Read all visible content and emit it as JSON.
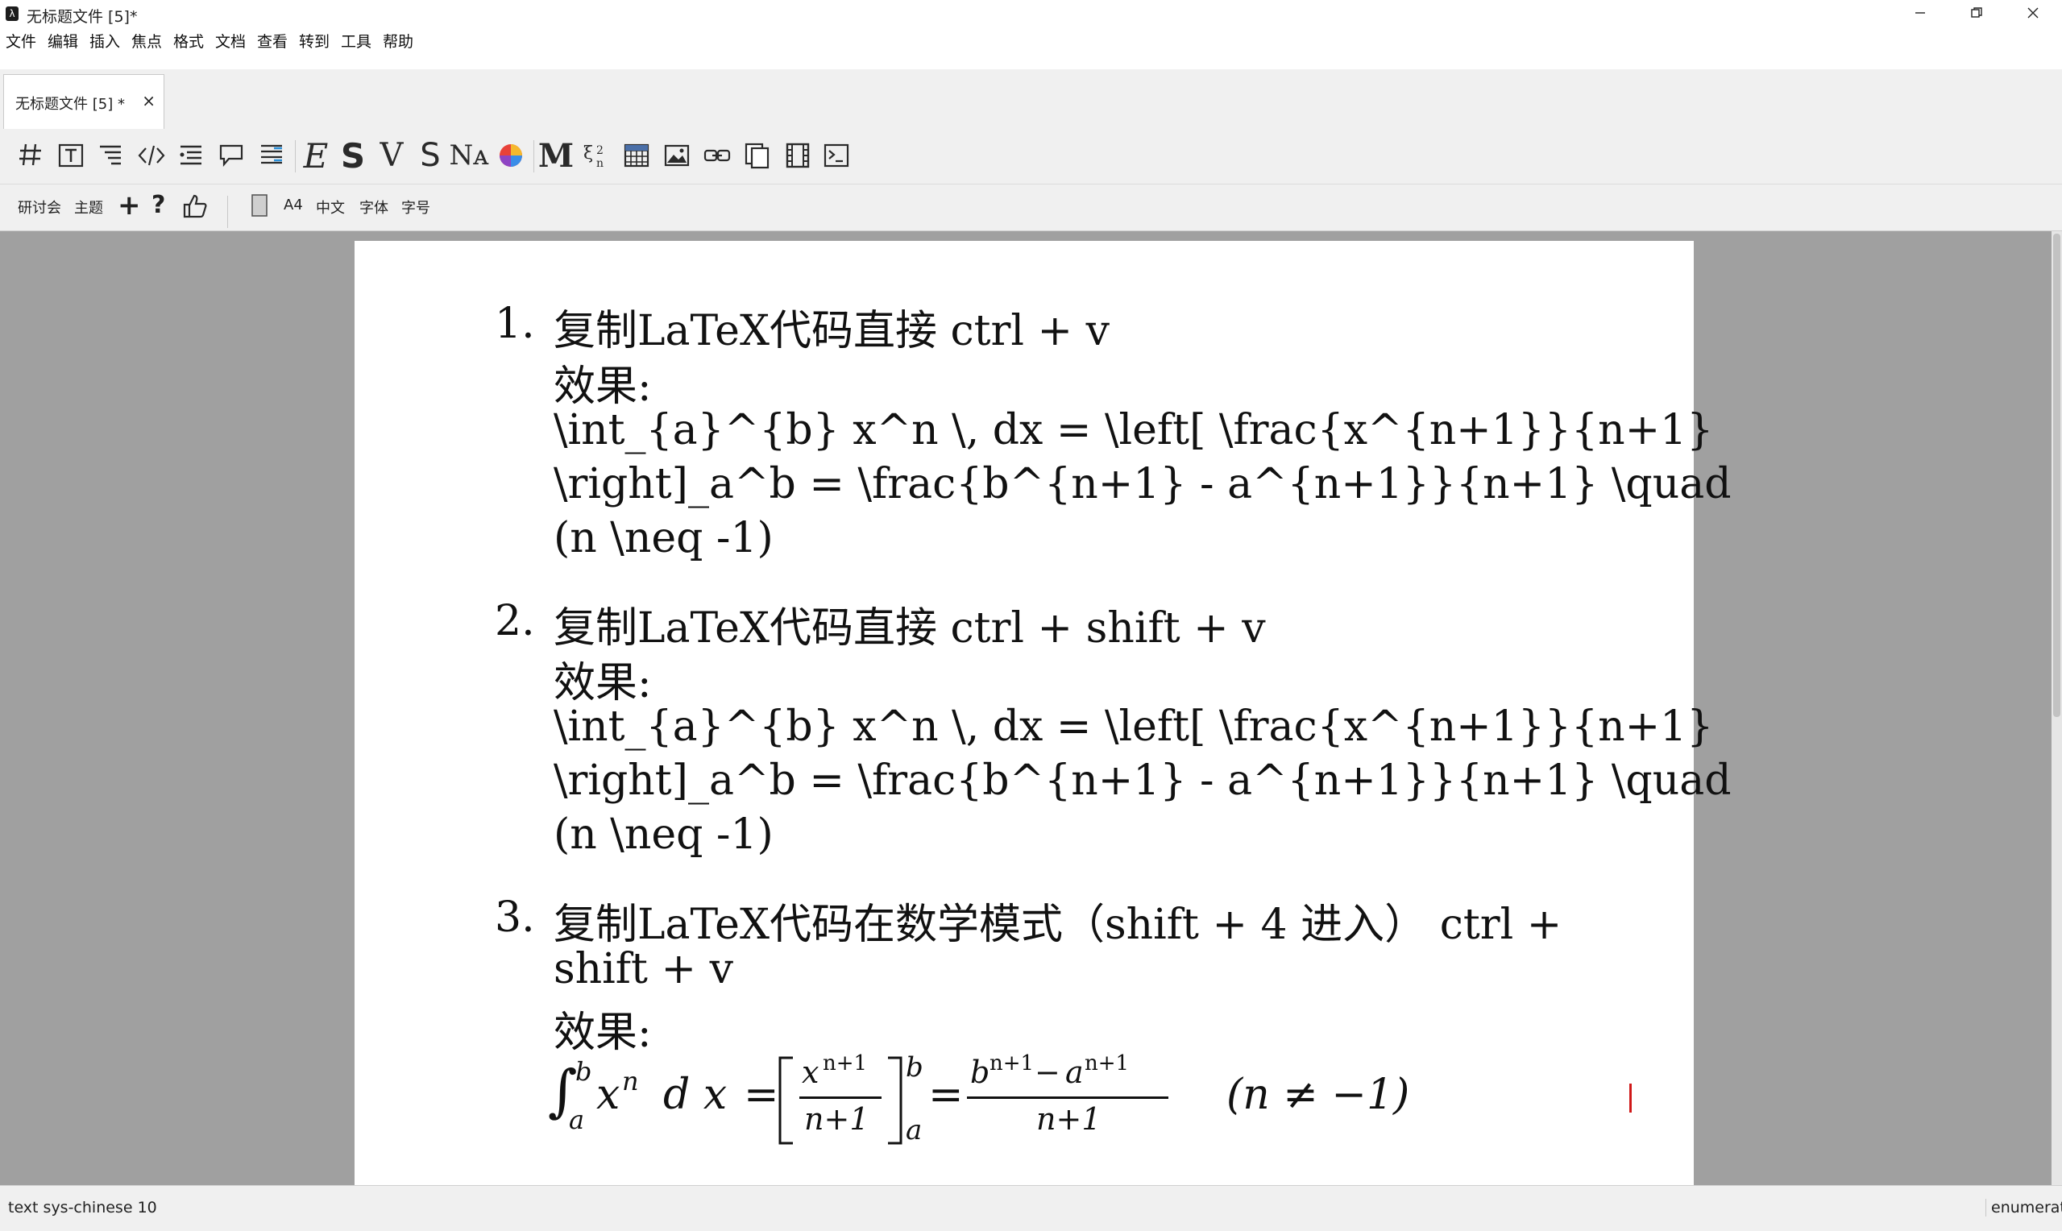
{
  "window": {
    "title": "无标题文件 [5]*",
    "app_icon": "texmacs-icon"
  },
  "window_controls": [
    "minimize-icon",
    "restore-icon",
    "close-icon"
  ],
  "menu": [
    "文件",
    "编辑",
    "插入",
    "焦点",
    "格式",
    "文档",
    "查看",
    "转到",
    "工具",
    "帮助"
  ],
  "tab": {
    "label": "无标题文件 [5] *",
    "close": "×"
  },
  "toolbar1_icons": [
    "section-icon",
    "text-box-icon",
    "indent-icon",
    "code-icon",
    "list-icon",
    "comment-icon",
    "paragraph-icon",
    "emphasis-icon",
    "strong-icon",
    "verbatim-icon",
    "sans-serif-icon",
    "small-caps-icon",
    "color-wheel-icon",
    "math-mode-icon",
    "formula-icon",
    "table-icon",
    "image-icon",
    "link-icon",
    "copy-icon",
    "film-icon",
    "terminal-icon"
  ],
  "toolbar2": {
    "seminar": "研讨会",
    "theme": "主题",
    "add": "+",
    "help": "?",
    "paper": "A4",
    "lang": "中文",
    "font": "字体",
    "size": "字号"
  },
  "document": {
    "items": [
      {
        "number": "1.",
        "heading": "复制LaTeX代码直接 ctrl + v",
        "effect": "效果:",
        "code_lines": [
          "\\int_{a}^{b} x^n \\, dx = \\left[ \\frac{x^{n+1}}{n+1}",
          "\\right]_a^b = \\frac{b^{n+1} - a^{n+1}}{n+1} \\quad",
          "(n \\neq -1)"
        ]
      },
      {
        "number": "2.",
        "heading": "复制LaTeX代码直接 ctrl + shift + v",
        "effect": "效果:",
        "code_lines": [
          "\\int_{a}^{b} x^n \\, dx = \\left[ \\frac{x^{n+1}}{n+1}",
          "\\right]_a^b = \\frac{b^{n+1} - a^{n+1}}{n+1} \\quad",
          "(n \\neq -1)"
        ]
      },
      {
        "number": "3.",
        "heading_lines": [
          "复制LaTeX代码在数学模式（shift + 4 进入） ctrl +",
          "shift + v"
        ],
        "effect": "效果:",
        "formula": {
          "int_lower": "a",
          "int_upper": "b",
          "integrand": "x",
          "power": "n",
          "dx": "d x",
          "eq": "=",
          "frac1_num": "x",
          "frac1_num_sup": "n+1",
          "frac1_den": "n+1",
          "bracket_upper": "b",
          "bracket_lower": "a",
          "frac2_num": "b",
          "frac2_num_sup1": "n+1",
          "minus": "−",
          "frac2_num_a": "a",
          "frac2_num_sup2": "n+1",
          "frac2_den": "n+1",
          "condition": "(n ≠ −1)"
        }
      }
    ]
  },
  "status": {
    "left": "text sys-chinese 10",
    "right": "enumerate"
  }
}
